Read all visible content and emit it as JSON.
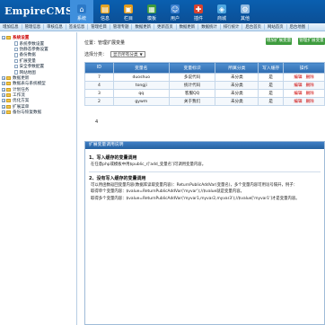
{
  "header": {
    "logo_main": "EmpireCMS",
    "nav": [
      {
        "label": "系统",
        "icon": "home-icon",
        "color": "#2b78c6",
        "active": true
      },
      {
        "label": "信息",
        "icon": "doc-icon",
        "color": "#e3a324"
      },
      {
        "label": "栏目",
        "icon": "folder-icon",
        "color": "#e39a1a"
      },
      {
        "label": "模板",
        "icon": "template-icon",
        "color": "#3d9a3d"
      },
      {
        "label": "用户",
        "icon": "user-icon",
        "color": "#3a7fcf"
      },
      {
        "label": "插件",
        "icon": "plugin-icon",
        "color": "#d9432f"
      },
      {
        "label": "商城",
        "icon": "shop-icon",
        "color": "#4fa7e0"
      },
      {
        "label": "其他",
        "icon": "gear-icon",
        "color": "#8fb9e0"
      }
    ]
  },
  "subnav": [
    "增加信息",
    "管理信息",
    "审核信息",
    "签发信息",
    "管理栏目",
    "管理专题",
    "数据更新",
    "更新首页",
    "数据更新",
    "数据统计",
    "排行统计",
    "后台首页",
    "网站首页",
    "后台地图"
  ],
  "sidebar": [
    {
      "label": "系统设置",
      "level": 0,
      "expanded": true,
      "bold": true,
      "sel": true
    },
    {
      "label": "系统参数设置",
      "level": 1
    },
    {
      "label": "伪静态参数设置",
      "level": 1
    },
    {
      "label": "备份数据",
      "level": 1
    },
    {
      "label": "扩展变量",
      "level": 1
    },
    {
      "label": "安全参数配置",
      "level": 1
    },
    {
      "label": "网站地图",
      "level": 1
    },
    {
      "label": "数据更新",
      "level": 0
    },
    {
      "label": "数据表与系统模型",
      "level": 0
    },
    {
      "label": "计划任务",
      "level": 0
    },
    {
      "label": "工作流",
      "level": 0
    },
    {
      "label": "优化方案",
      "level": 0
    },
    {
      "label": "扩展菜单",
      "level": 0
    },
    {
      "label": "备份与恢复数据",
      "level": 0
    }
  ],
  "main": {
    "location": "位置：管理扩展变量",
    "add_button": "增加扩展变量",
    "add_button2": "管理扩展变量",
    "filter_label": "选择分类：",
    "filter_value": "显示所有分类",
    "table": {
      "headers": [
        "ID",
        "变量名",
        "变量标识",
        "所属分类",
        "写入缓存",
        "操作"
      ],
      "rows": [
        {
          "id": "7",
          "name": "duoshuo",
          "tag": "多说代码",
          "cat": "未分类",
          "cache": "是",
          "ops": [
            "编辑",
            "删除"
          ]
        },
        {
          "id": "4",
          "name": "tongji",
          "tag": "统计代码",
          "cat": "未分类",
          "cache": "是",
          "ops": [
            "编辑",
            "删除"
          ]
        },
        {
          "id": "3",
          "name": "qq",
          "tag": "客服QQ",
          "cat": "未分类",
          "cache": "是",
          "ops": [
            "编辑",
            "删除"
          ]
        },
        {
          "id": "2",
          "name": "gywm",
          "tag": "关于我们",
          "cat": "未分类",
          "cache": "是",
          "ops": [
            "编辑",
            "删除"
          ]
        }
      ]
    },
    "page_number": "4"
  },
  "panel": {
    "title": "扩展变量调用说明",
    "sec1_title": "1、写入缓存的变量调用",
    "sec1_line": "在任意php或模板中用$public_r['add_变量名']可调用变量内容。",
    "sec2_title": "2、没有写入缓存的变量调用",
    "sec2_lines": [
      "可以用函数返回变量内容(数据库读取变量内容)：ReturnPublicAddVar(变量名)，多个变量内容可用逗号隔开，例子：",
      "取得单个变量内容：$value=ReturnPublicAddVar('myvar');//$value就是变量内容。",
      "取得多个变量内容：$value=ReturnPublicAddVar('myvar1,myvar2,myvar3');//$value['myvar1']才是变量内容。"
    ]
  }
}
